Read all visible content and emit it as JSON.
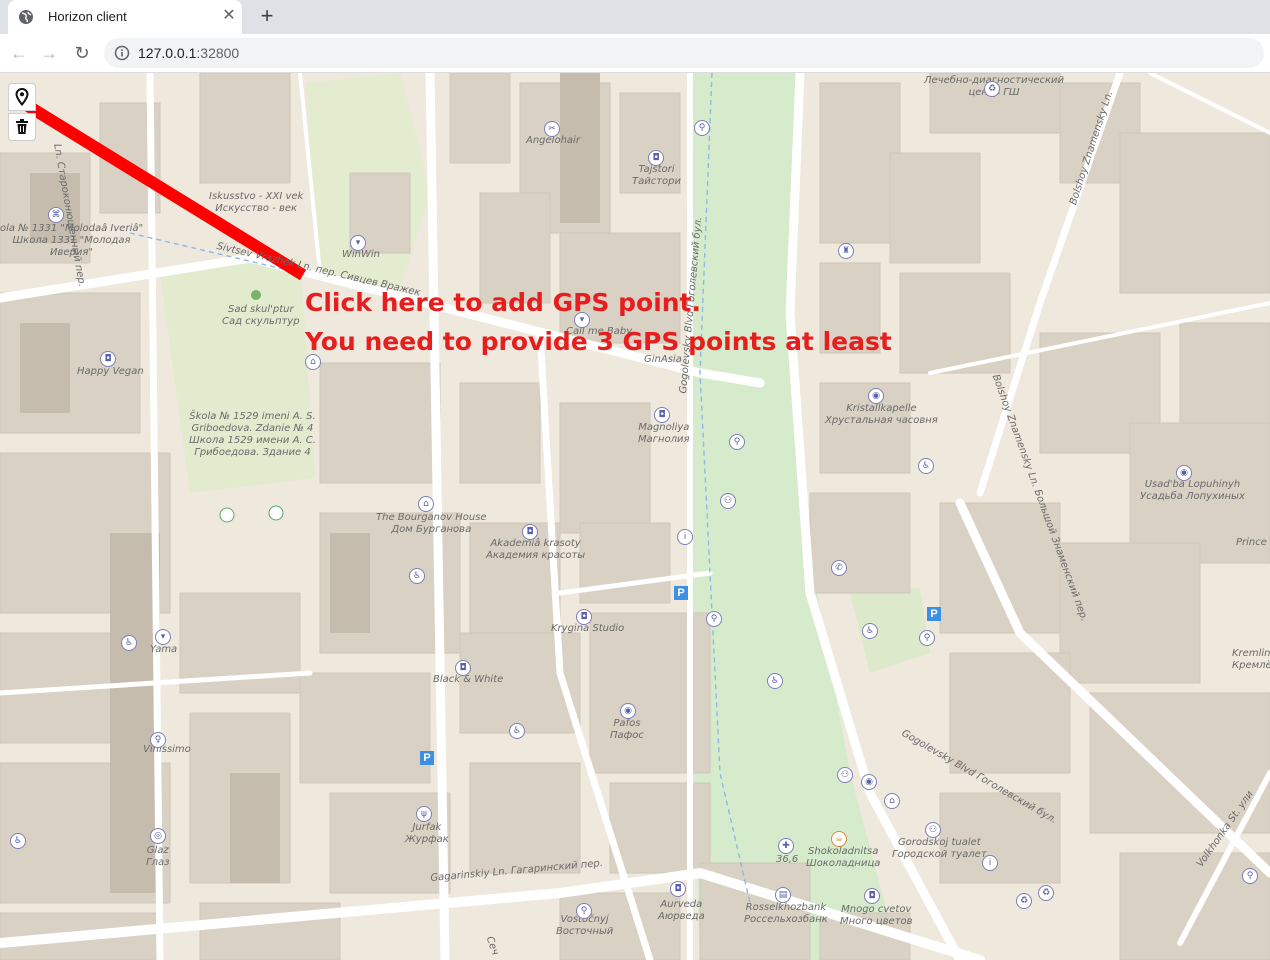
{
  "browser": {
    "tab_title": "Horizon client",
    "tab_close_glyph": "✕",
    "new_tab_glyph": "+",
    "back_glyph": "←",
    "forward_glyph": "→",
    "reload_glyph": "↻",
    "url_host": "127.0.0.1",
    "url_port": ":32800"
  },
  "map": {
    "controls": [
      {
        "name": "add-gps-point",
        "icon": "map-pin-icon"
      },
      {
        "name": "clear-points",
        "icon": "trash-icon"
      }
    ],
    "hint_line1": "Click here to add GPS point.",
    "hint_line2": "You need to provide 3 GPS points at least",
    "arrow_color": "#ff0000",
    "labels": {
      "clinic1": "Лечебно-диагностический",
      "clinic2": "центр ГШ",
      "angelohair": "Angelohair",
      "tajstori1": "Tajstori",
      "tajstori2": "Тайстори",
      "iskusstvo1": "Iskusstvo - XXI vek",
      "iskusstvo2": "Искусство - век",
      "school1331_1": "ola № 1331 \"Molodaâ Iveriâ\"",
      "school1331_2": "Школа 1331 \"Молодая",
      "school1331_3": "Иверия\"",
      "winwin": "WinWin",
      "sivtsev": "Sivtsev Vrazhek Ln. пер. Сивцев Вражек",
      "starokon": "Ln. Староконюшенный пер.",
      "gogolevsky_vert": "Gogolevsky Blvd Гоголевский бул.",
      "bolshoy_znam_top": "Bolshoy Znamensky Ln.",
      "bolshoy_znam_vert": "Bolshoy Znamensky Ln. Большой Знаменский пер.",
      "sad1": "Sad skul'ptur",
      "sad2": "Сад скульптур",
      "happy_vegan": "Happy Vegan",
      "ginasia": "GinAsia",
      "callmebaby": "Call me Baby",
      "kristall1": "Kristallkapelle",
      "kristall2": "Хрустальная часовня",
      "magnolia1": "Magnoliya",
      "magnolia2": "Магнолия",
      "skola1529_1": "Škola № 1529 imeni A. S.",
      "skola1529_2": "Griboedova. Zdanie № 4",
      "skola1529_3": "Школа 1529 имени А. С.",
      "skola1529_4": "Грибоедова. Здание 4",
      "usadba1": "Usad'ba Lopuhinyh",
      "usadba2": "Усадьба Лопухиных",
      "bourganov1": "The Bourganov House",
      "bourganov2": "Дом Бурганова",
      "akademia1": "Akademiâ krasoty",
      "akademia2": "Академия красоты",
      "prince": "Prince C",
      "krygina": "Krygina Studio",
      "yama": "Yama",
      "kremlin1": "Kremlin",
      "kremlin2": "Кремлё",
      "black_white": "Black & White",
      "pafos1": "Pafos",
      "pafos2": "Пафос",
      "vinissimo": "Vinissimo",
      "gogolevsky_diag": "Gogolevsky Blvd Гоголевский бул.",
      "jurfak1": "Jurfak",
      "jurfak2": "Журфак",
      "glaz1": "Glaz",
      "glaz2": "Глаз",
      "gorodskoj1": "Gorodskoj tualet",
      "gorodskoj2": "Городской туалет",
      "shokoladnica1": "Shokoladnitsa",
      "shokoladnica2": "Шоколадница",
      "house366": "36,6",
      "volkhonka": "Volkhonka St. ули",
      "gagarinsky": "Gagarinskiy Ln. Гагаринский пер.",
      "aurveda1": "Aurveda",
      "aurveda2": "Аюрведа",
      "rossel1": "Rosselkhozbank",
      "rossel2": "Россельхозбанк",
      "mnogo1": "Mnogo cvetov",
      "mnogo2": "Много цветов",
      "vostochny1": "Vostočnyj",
      "vostochny2": "Восточный",
      "sechen": "Сеч"
    },
    "parking_label": "P"
  }
}
